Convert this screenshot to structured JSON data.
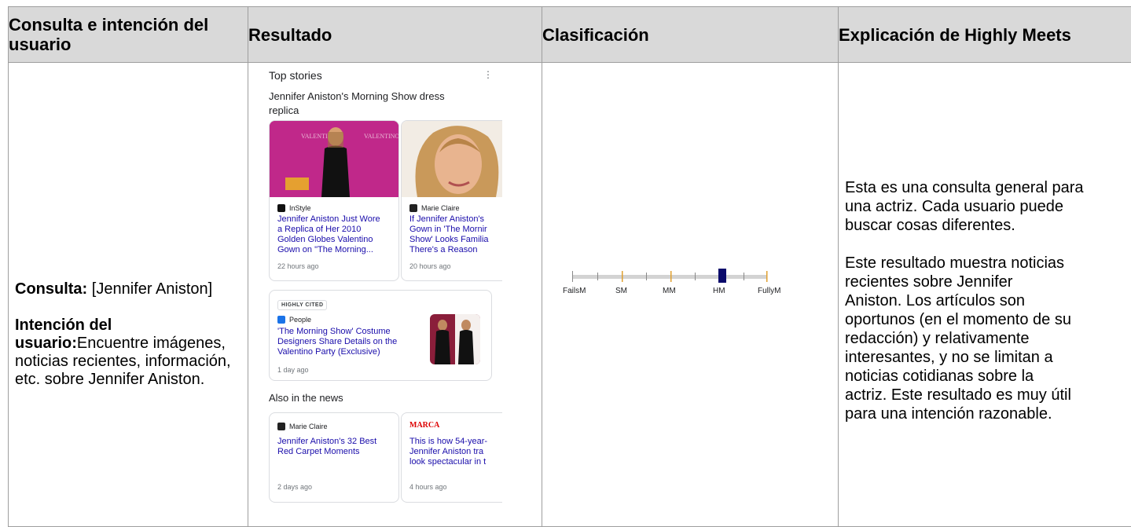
{
  "headers": {
    "query": "Consulta e intención del usuario",
    "result": "Resultado",
    "rating": "Clasificación",
    "explanation": "Explicación de Highly Meets"
  },
  "query": {
    "label": "Consulta:",
    "value": " [Jennifer Aniston]",
    "intent_label": "Intención del usuario:",
    "intent_value": "Encuentre imágenes, noticias recientes, información, etc. sobre Jennifer Aniston."
  },
  "result": {
    "section_title": "Top stories",
    "story_heading": "Jennifer Aniston's Morning Show dress replica",
    "cards": [
      {
        "source": "InStyle",
        "headline": [
          "Jennifer Aniston Just Wore",
          "a Replica of Her 2010",
          "Golden Globes Valentino",
          "Gown on \"The Morning..."
        ],
        "time": "22 hours ago"
      },
      {
        "source": "Marie Claire",
        "headline": [
          "If Jennifer Aniston's",
          "Gown in 'The Mornir",
          "Show' Looks Familia",
          "There's a Reason"
        ],
        "time": "20 hours ago"
      },
      {
        "badge": "HIGHLY CITED",
        "source": "People",
        "headline": [
          "'The Morning Show' Costume",
          "Designers Share Details on the",
          "Valentino Party (Exclusive)"
        ],
        "time": "1 day ago"
      }
    ],
    "also_title": "Also in the news",
    "also_cards": [
      {
        "source": "Marie Claire",
        "headline": [
          "Jennifer Aniston's 32 Best",
          "Red Carpet Moments"
        ],
        "time": "2 days ago"
      },
      {
        "source": "MARCA",
        "headline": [
          "This is how 54-year-",
          "Jennifer Aniston tra",
          "look spectacular in t"
        ],
        "time": "4 hours ago"
      }
    ]
  },
  "rating": {
    "labels": [
      "FailsM",
      "SM",
      "MM",
      "HM",
      "FullyM"
    ],
    "selected": "HM",
    "colors": {
      "marker": "#0a0a6b",
      "track": "#d3d3d3",
      "tick": "#e0a030"
    }
  },
  "explanation": {
    "paragraph1": [
      "Esta es una consulta general para",
      "una actriz. Cada usuario puede",
      "buscar cosas diferentes."
    ],
    "paragraph2": [
      "Este resultado muestra noticias",
      "recientes sobre Jennifer",
      "Aniston. Los artículos son",
      "oportunos (en el momento de su",
      "redacción) y relativamente",
      "interesantes, y no se limitan a",
      "noticias cotidianas sobre la",
      "actriz. Este resultado es muy útil",
      "para una intención razonable."
    ]
  }
}
